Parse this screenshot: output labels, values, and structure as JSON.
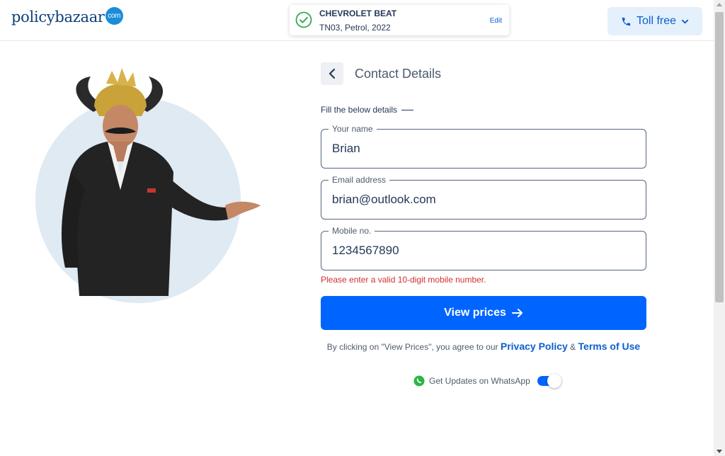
{
  "brand": {
    "name_part1": "policy",
    "name_part2": "bazaar",
    "suffix": "com"
  },
  "car": {
    "model": "CHEVROLET BEAT",
    "details": "TN03, Petrol, 2022",
    "edit_label": "Edit",
    "check_color": "#3aa757"
  },
  "header": {
    "toll_label": "Toll free",
    "accent": "#0b5fd1"
  },
  "form": {
    "title": "Contact Details",
    "subtitle": "Fill the below details",
    "name": {
      "label": "Your name",
      "value": "Brian"
    },
    "email": {
      "label": "Email address",
      "value": "brian@outlook.com"
    },
    "mobile": {
      "label": "Mobile no.",
      "value": "1234567890"
    },
    "error": "Please enter a valid 10-digit mobile number.",
    "cta_label": "View prices",
    "terms_prefix": "By clicking on \"View Prices\", you agree to our",
    "privacy_label": "Privacy Policy",
    "amp": "&",
    "terms_label": "Terms of Use",
    "whatsapp_label": "Get Updates on WhatsApp",
    "whatsapp_enabled": true
  },
  "colors": {
    "primary": "#0065ff",
    "error": "#d32f2f",
    "text": "#253858",
    "circle_bg": "#dfeaf3"
  }
}
